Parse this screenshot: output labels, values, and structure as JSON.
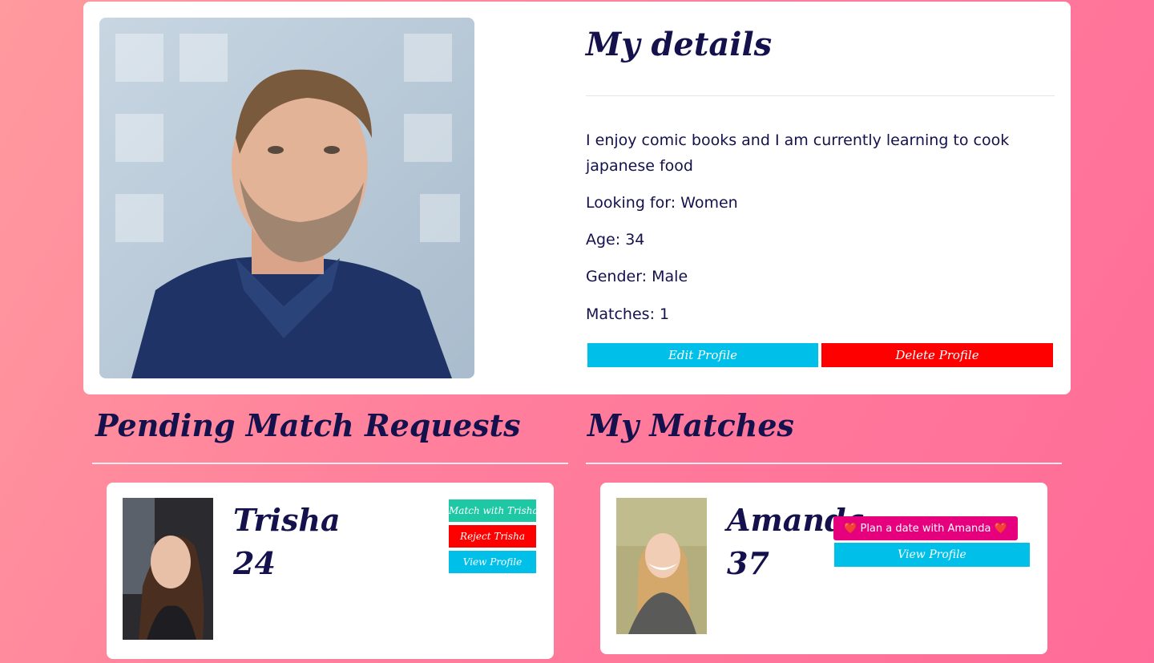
{
  "profile": {
    "title": "My details",
    "bio": "I enjoy comic books and I am currently learning to cook japanese food",
    "looking_for": "Looking for: Women",
    "age": "Age: 34",
    "gender": "Gender: Male",
    "matches": "Matches: 1",
    "edit_label": "Edit Profile",
    "delete_label": "Delete Profile"
  },
  "pending": {
    "title": "Pending Match Requests",
    "requests": [
      {
        "name": "Trisha",
        "age": "24",
        "match_label": "Match with Trisha",
        "reject_label": "Reject Trisha",
        "view_label": "View Profile"
      }
    ]
  },
  "my_matches": {
    "title": "My Matches",
    "items": [
      {
        "name": "Amanda",
        "age": "37",
        "plan_label": "Plan a date with Amanda",
        "view_label": "View Profile"
      }
    ]
  },
  "colors": {
    "primary_text": "#14114d",
    "edit": "#00c0ea",
    "delete": "#ff0000",
    "match": "#1ec8a5",
    "plan_date": "#e6007e"
  }
}
